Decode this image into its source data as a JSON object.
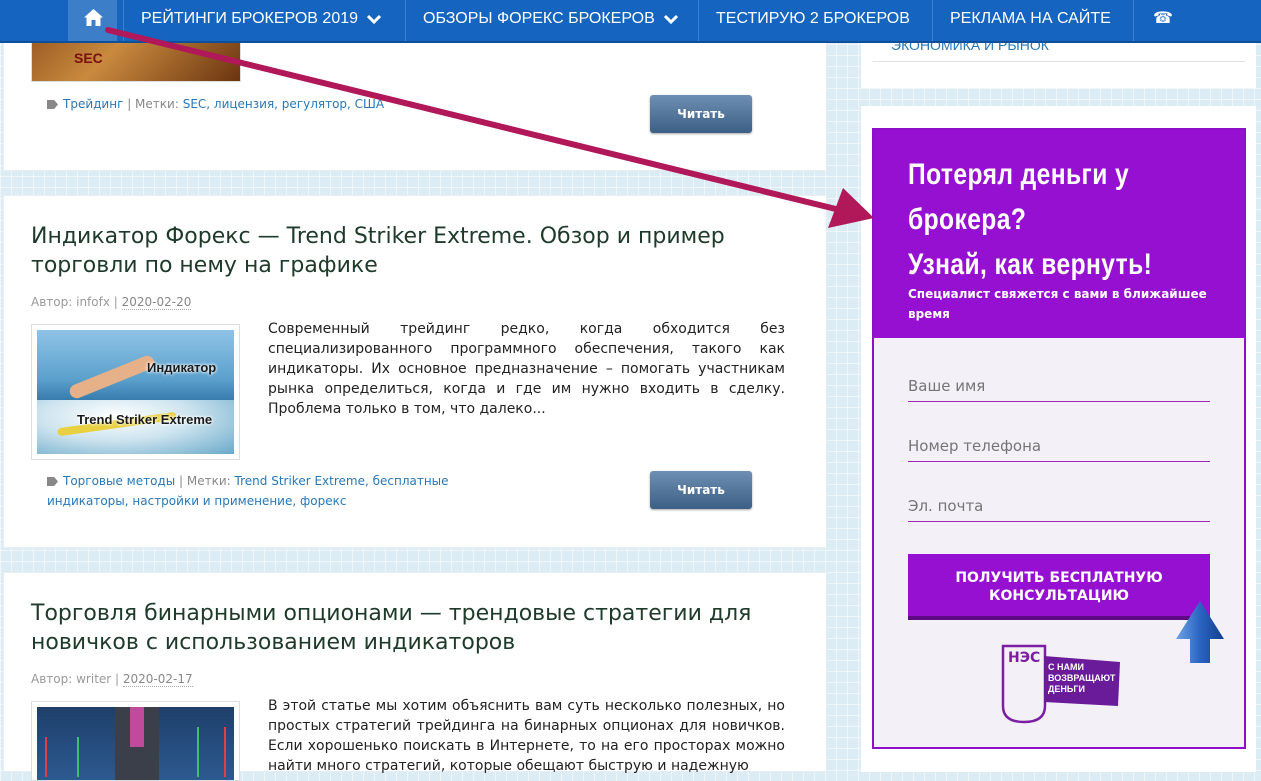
{
  "nav": {
    "items": [
      {
        "label": "РЕЙТИНГИ БРОКЕРОВ 2019"
      },
      {
        "label": "ОБЗОРЫ ФОРЕКС БРОКЕРОВ"
      },
      {
        "label": "ТЕСТИРУЮ 2 БРОКЕРОВ"
      },
      {
        "label": "РЕКЛАМА НА САЙТЕ"
      }
    ]
  },
  "post_top": {
    "category": "Трейдинг",
    "tags_label": "Метки:",
    "tags": "SEC, лицензия, регулятор, США",
    "read": "Читать",
    "thumb_text": "SEC"
  },
  "post1": {
    "title": "Индикатор Форекс — Trend Striker Extreme. Обзор и пример торговли по нему на графике",
    "author_label": "Автор:",
    "author": "infofx",
    "date": "2020-02-20",
    "thumb_line1": "Индикатор",
    "thumb_line2": "Trend Striker Extreme",
    "excerpt": "Современный трейдинг редко, когда обходится без специализированного программного обеспечения, такого как индикаторы. Их основное предназначение – помогать участникам рынка определиться, когда и где им нужно входить в сделку. Проблема только в том, что далеко...",
    "category": "Торговые методы",
    "tags_label": "Метки:",
    "tags": "Trend Striker Extreme, бесплатные индикаторы, настройки и применение, форекс",
    "read": "Читать"
  },
  "post2": {
    "title": "Торговля бинарными опционами — трендовые стратегии для новичков с использованием индикаторов",
    "author_label": "Автор:",
    "author": "writer",
    "date": "2020-02-17",
    "excerpt": "В этой статье мы хотим объяснить вам суть несколько полезных, но простых стратегий трейдинга на бинарных опционах для новичков. Если хорошенько поискать в Интернете, то на его просторах можно найти много стратегий, которые обещают быструю и надежную"
  },
  "sidebar": {
    "category": "Экономика и рынок"
  },
  "promo": {
    "title_line1": "Потерял деньги у",
    "title_line2": "брокера?",
    "title_line3": "Узнай, как вернуть!",
    "subtitle": "Специалист свяжется с вами в ближайшее время",
    "name_placeholder": "Ваше имя",
    "phone_placeholder": "Номер телефона",
    "email_placeholder": "Эл. почта",
    "cta": "ПОЛУЧИТЬ БЕСПЛАТНУЮ КОНСУЛЬТАЦИЮ",
    "logo_text": "С НАМИ ВОЗВРАЩАЮТ ДЕНЬГИ",
    "logo_letters": "НЭС"
  },
  "colors": {
    "nav": "#1565c0",
    "promo": "#9610d2",
    "annotation_arrow": "#b0185a"
  }
}
